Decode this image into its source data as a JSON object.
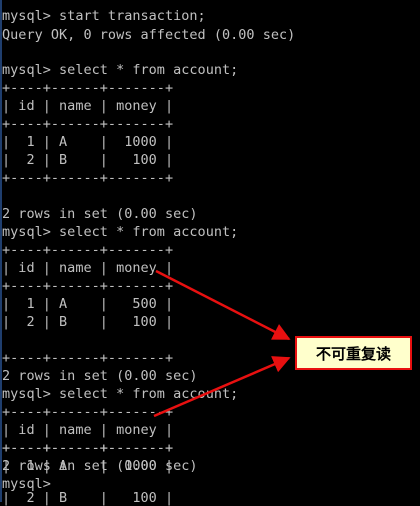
{
  "terminal": {
    "lines": [
      "mysql> start transaction;",
      "Query OK, 0 rows affected (0.00 sec)",
      "",
      "mysql> select * from account;",
      "+----+------+-------+",
      "| id | name | money |",
      "+----+------+-------+",
      "|  1 | A    |  1000 |",
      "|  2 | B    |   100 |",
      "+----+------+-------+",
      "2 rows in set (0.00 sec)",
      "",
      "mysql> select * from account;",
      "+----+------+-------+",
      "| id | name | money |",
      "+----+------+-------+",
      "|  1 | A    |   500 |",
      "|  2 | B    |   100 |",
      "+----+------+-------+",
      "2 rows in set (0.00 sec)",
      "",
      "mysql> select * from account;",
      "+----+------+-------+",
      "| id | name | money |",
      "+----+------+-------+",
      "|  1 | A    |  1000 |",
      "|  2 | B    |   100 |",
      "+----+------+-------+",
      "2 rows in set (0.00 sec)",
      "",
      "mysql>"
    ]
  },
  "annotation": {
    "label": "不可重复读",
    "color": "#e81010"
  },
  "colors": {
    "background": "#000000",
    "text": "#c0c0c0"
  }
}
